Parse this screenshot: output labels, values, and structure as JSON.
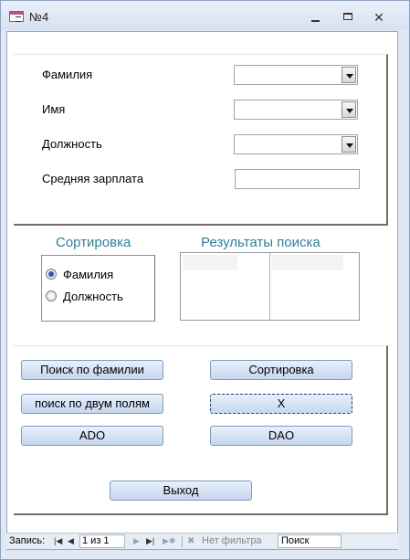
{
  "window": {
    "title": "№4",
    "icon": "form-icon",
    "minimize_icon": "minimize-icon",
    "maximize_icon": "maximize-icon",
    "close_icon": "close-icon",
    "close_glyph": "✕"
  },
  "fields": {
    "surname_label": "Фамилия",
    "name_label": "Имя",
    "position_label": "Должность",
    "avg_salary_label": "Средняя зарплата",
    "surname_value": "",
    "name_value": "",
    "position_value": "",
    "avg_salary_value": ""
  },
  "sorting": {
    "title": "Сортировка",
    "options": [
      {
        "label": "Фамилия",
        "checked": true
      },
      {
        "label": "Должность",
        "checked": false
      }
    ]
  },
  "results": {
    "title": "Результаты поиска"
  },
  "buttons": {
    "search_surname": "Поиск по фамилии",
    "sort": "Сортировка",
    "search_two_fields": "поиск по двум полям",
    "x": "X",
    "ado": "ADO",
    "dao": "DAO",
    "exit": "Выход"
  },
  "navigation": {
    "record_label": "Запись:",
    "position": "1 из 1",
    "filter_text": "Нет фильтра",
    "search_placeholder": "Поиск"
  },
  "colors": {
    "section_title": "#2f7f9a",
    "button_fill": "#c5d6ee",
    "frame_bg": "#dfe8f4"
  }
}
